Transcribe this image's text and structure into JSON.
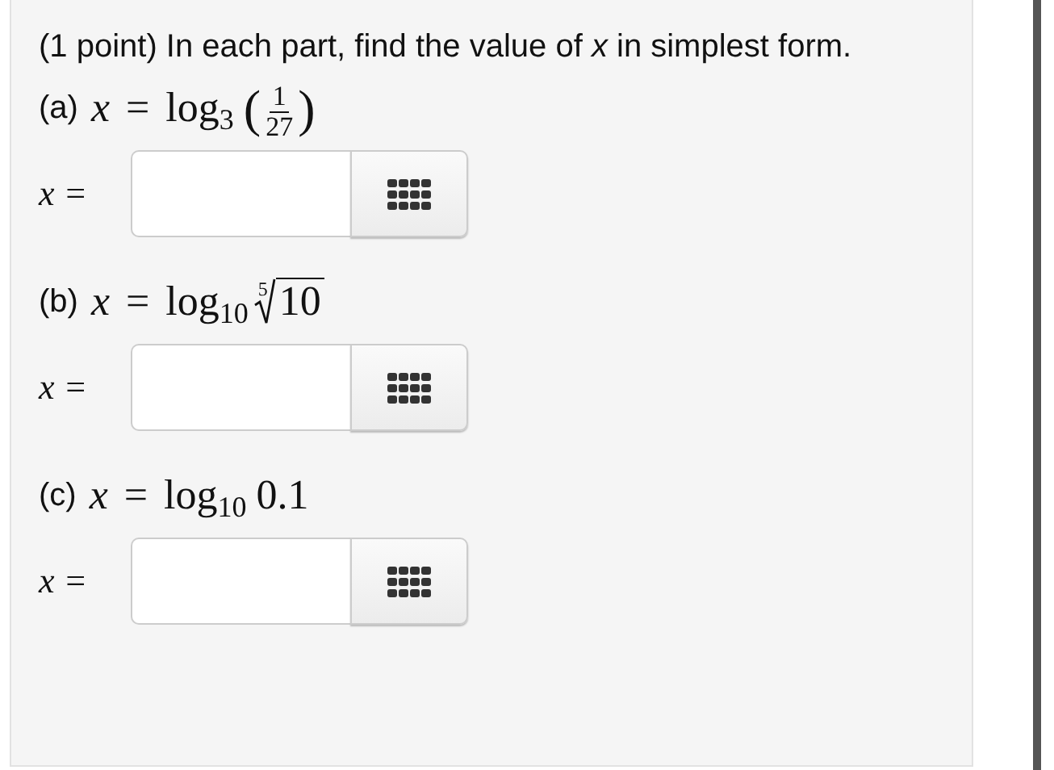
{
  "problem": {
    "statement": "(1 point) In each part, find the value of *x* in simplest form."
  },
  "parts": [
    {
      "label": "(a)",
      "variable": "x",
      "relation": "=",
      "function": "log$_{3}$",
      "argument": {
        "kind": "fraction",
        "open": "(",
        "numerator": "1",
        "denominator": "27",
        "close": ")"
      },
      "answer_label": "x ="
    },
    {
      "label": "(b)",
      "variable": "x",
      "relation": "=",
      "function": "log$_{10}$",
      "argument": {
        "kind": "root",
        "index": "5",
        "radicand": "10"
      },
      "answer_label": "x ="
    },
    {
      "label": "(c)",
      "variable": "x",
      "relation": "=",
      "function": "log$_{10}$",
      "argument": {
        "kind": "number",
        "text": "0.1"
      },
      "answer_label": "x ="
    }
  ]
}
